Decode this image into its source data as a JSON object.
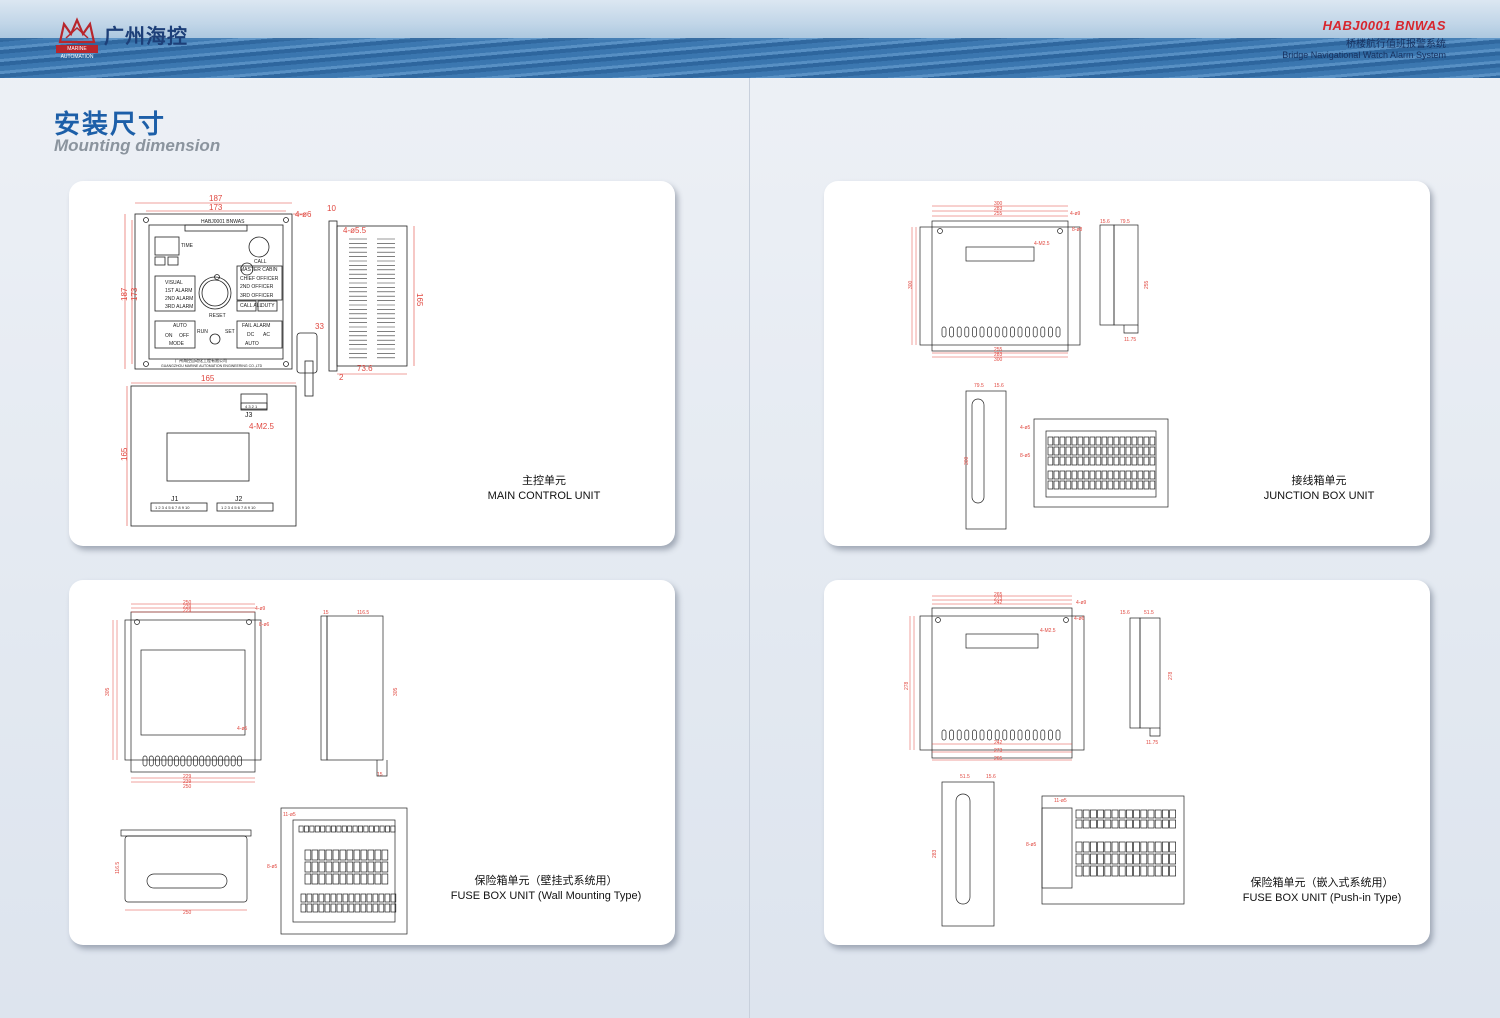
{
  "header": {
    "brand_name": "广州海控",
    "brand_sub": "MARINE AUTOMATION",
    "product_code": "HABJ0001 BNWAS",
    "product_cn": "桥楼航行值班报警系统",
    "product_en": "Bridge Navigational Watch Alarm System"
  },
  "page_title": {
    "cn": "安装尺寸",
    "en": "Mounting dimension"
  },
  "panels": [
    {
      "caption_cn": "主控单元",
      "caption_en": "MAIN CONTROL UNIT"
    },
    {
      "caption_cn": "接线箱单元",
      "caption_en": "JUNCTION BOX UNIT"
    },
    {
      "caption_cn": "保险箱单元（壁挂式系统用）",
      "caption_en": "FUSE BOX UNIT (Wall Mounting Type)"
    },
    {
      "caption_cn": "保险箱单元（嵌入式系统用）",
      "caption_en": "FUSE BOX UNIT (Push-in Type)"
    }
  ],
  "main_unit": {
    "dim_width_outer": "187",
    "dim_width_inner": "173",
    "dim_height_outer": "187",
    "dim_height_inner": "173",
    "dim_holes": "4-ø6",
    "dim_side_top": "10",
    "dim_side_holes": "4-ø5.5",
    "dim_side_height": "165",
    "dim_key": "33",
    "dim_side_depth": "73.6",
    "dim_side_bottom": "2",
    "dim_back_width": "165",
    "dim_back_height": "165",
    "dim_back_holes": "4-M2.5",
    "model_label": "HABJ0001 BNWAS",
    "time_label": "TIME",
    "call_label": "CALL",
    "reset_label": "RESET",
    "run_label": "RUN",
    "set_label": "SET",
    "auto_label": "AUTO",
    "on_label": "ON",
    "off_label": "OFF",
    "mode_label": "MODE",
    "visual_label": "VISUAL",
    "alarm1_label": "1ST ALARM",
    "alarm2_label": "2ND ALARM",
    "alarm3_label": "3RD ALARM",
    "master_label": "MASTER CABIN",
    "chief_label": "CHIEF OFFICER",
    "officer2_label": "2ND OFFICER",
    "officer3_label": "3RD OFFICER",
    "callall_label": "CALL ALL",
    "duty_label": "DUTY",
    "fail_label": "FAIL ALARM",
    "dc_label": "DC",
    "ac_label": "AC",
    "auto2_label": "AUTO",
    "maker_cn": "广州海控自动化工程有限公司",
    "maker_en": "GUANGZHOU MARINE AUTOMATION ENGINEERING CO.,LTD",
    "j3_label": "J3",
    "j1_label": "J1",
    "j2_label": "J2",
    "j3_pins": "4 3 2 1",
    "j_pins": "1 2 3 4 5 6 7 8 9 10"
  },
  "junction_box": {
    "w1": "300",
    "w2": "283",
    "w3": "255",
    "holes": "4-ø9",
    "holes2": "4-M2.5",
    "holes3": "8-ø8",
    "h1": "300",
    "h2": "283",
    "h3": "255",
    "side_top1": "15.6",
    "side_top2": "79.5",
    "side_h": "255",
    "side_bottom": "11.75",
    "bot1": "255",
    "bot2": "283",
    "bot3": "300",
    "rail_w1": "79.5",
    "rail_w2": "15.6",
    "rail_h": "300",
    "term_holes1": "4-ø5",
    "term_holes2": "8-ø5"
  },
  "fuse_wall": {
    "w1": "250",
    "w2": "239",
    "w3": "229",
    "holes": "4-ø9",
    "holes2": "8-ø6",
    "holes3": "4-ø5",
    "h1": "305",
    "h2": "290",
    "h3": "280",
    "side_top1": "15",
    "side_top2": "116.5",
    "side_h": "305",
    "side_bottom": "15",
    "bot1": "229",
    "bot2": "239",
    "bot3": "250",
    "cover_h": "116.5",
    "cover_w": "250",
    "term_holes1": "11-ø5",
    "term_holes2": "8-ø5"
  },
  "fuse_push": {
    "w1": "265",
    "w2": "273",
    "w3": "242",
    "holes": "4-ø9",
    "holes2": "4-ø6",
    "holes3": "4-M2.5",
    "h1": "278",
    "h2": "273",
    "h3": "242",
    "side_top1": "15.6",
    "side_top2": "51.5",
    "side_h": "278",
    "side_bottom": "11.75",
    "bot1": "242",
    "bot2": "273",
    "bot3": "265",
    "rail_w1": "51.5",
    "rail_w2": "15.6",
    "rail_h": "283",
    "term_holes1": "11-ø5",
    "term_holes2": "8-ø5"
  },
  "colors": {
    "title_blue": "#1d5fa8",
    "accent_red": "#d7262e",
    "dim_red": "#e0473f",
    "line": "#222222"
  }
}
